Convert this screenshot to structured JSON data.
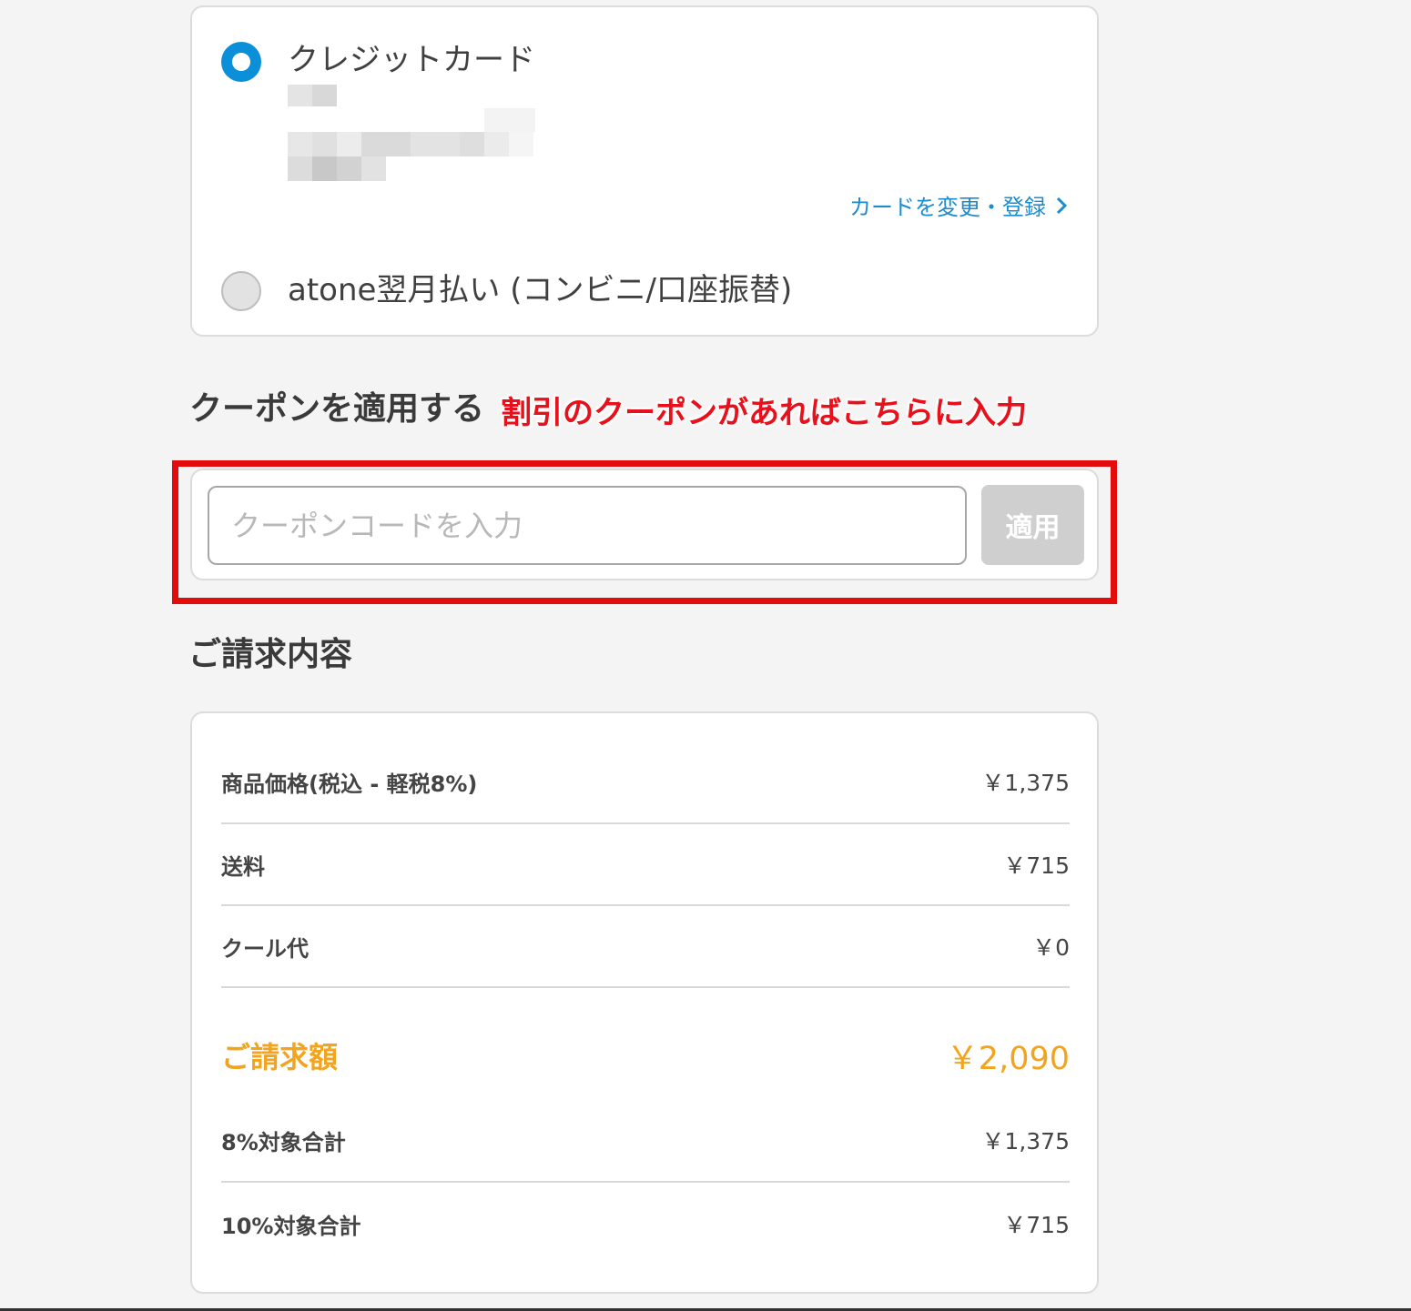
{
  "payment": {
    "credit_label": "クレジットカード",
    "change_link": "カードを変更・登録",
    "atone_label": "atone翌月払い (コンビニ/口座振替)"
  },
  "coupon": {
    "title": "クーポンを適用する",
    "annotation": "割引のクーポンがあればこちらに入力",
    "placeholder": "クーポンコードを入力",
    "apply_label": "適用"
  },
  "billing": {
    "title": "ご請求内容",
    "rows": [
      {
        "label": "商品価格(税込 - 軽税8%)",
        "value": "￥1,375"
      },
      {
        "label": "送料",
        "value": "￥715"
      },
      {
        "label": "クール代",
        "value": "￥0"
      },
      {
        "label": "ご請求額",
        "value": "￥2,090"
      },
      {
        "label": "8%対象合計",
        "value": "￥1,375"
      },
      {
        "label": "10%対象合計",
        "value": "￥715"
      }
    ]
  },
  "colors": {
    "accent_blue": "#0a8fd8",
    "total_orange": "#f2a41f",
    "annotation_red": "#e20c0c"
  }
}
